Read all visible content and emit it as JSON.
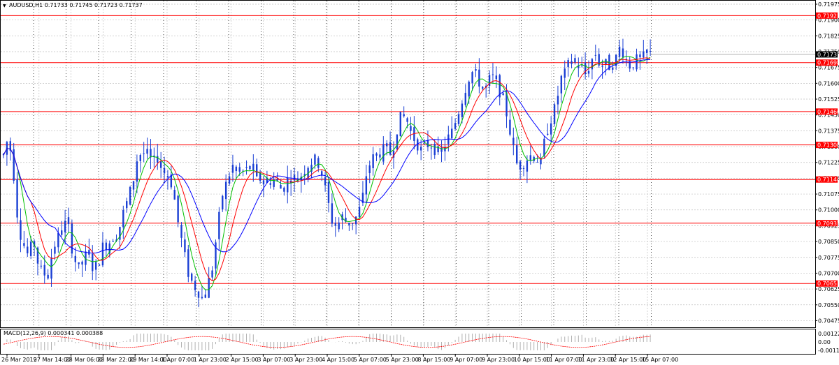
{
  "window": {
    "symbol_line": "AUDUSD,H1  0.71733 0.71745 0.71723 0.71737"
  },
  "chart_data": [
    {
      "type": "candlestick",
      "symbol": "AUDUSD",
      "timeframe": "H1",
      "ohlc_header": {
        "open": 0.71733,
        "high": 0.71745,
        "low": 0.71723,
        "close": 0.71737
      },
      "current_price_label": "0.71737",
      "current_price": 0.71737,
      "ylim": [
        0.7045,
        0.71975
      ],
      "y_tick_labels": [
        "0.71975",
        "0.71900",
        "0.71825",
        "0.71750",
        "0.71675",
        "0.71600",
        "0.71525",
        "0.71450",
        "0.71375",
        "0.71300",
        "0.71225",
        "0.71150",
        "0.71075",
        "0.71000",
        "0.70925",
        "0.70850",
        "0.70775",
        "0.70700",
        "0.70625",
        "0.70550",
        "0.70475"
      ],
      "x_tick_labels": [
        "26 Mar 2019",
        "27 Mar 14:00",
        "28 Mar 06:00",
        "28 Mar 22:00",
        "29 Mar 14:00",
        "1 Apr 07:00",
        "1 Apr 23:00",
        "2 Apr 15:00",
        "3 Apr 07:00",
        "3 Apr 23:00",
        "4 Apr 15:00",
        "5 Apr 07:00",
        "5 Apr 23:00",
        "8 Apr 15:00",
        "9 Apr 07:00",
        "9 Apr 23:00",
        "10 Apr 15:00",
        "11 Apr 07:00",
        "11 Apr 23:00",
        "12 Apr 15:00",
        "15 Apr 07:00"
      ],
      "horizontal_levels": [
        {
          "value": 0.71921,
          "label": "0.71921"
        },
        {
          "value": 0.71698,
          "label": "0.71698"
        },
        {
          "value": 0.71466,
          "label": "0.71466"
        },
        {
          "value": 0.71308,
          "label": "0.71308"
        },
        {
          "value": 0.71144,
          "label": "0.71144"
        },
        {
          "value": 0.70937,
          "label": "0.70937"
        },
        {
          "value": 0.70651,
          "label": "0.70651"
        }
      ],
      "close_path": {
        "x_index": [
          0,
          4,
          9,
          14,
          19,
          25,
          30,
          35,
          40,
          46,
          51,
          56,
          61,
          66,
          71,
          77,
          82,
          87,
          92,
          97,
          103,
          108,
          113,
          118,
          123,
          128,
          133,
          138,
          144,
          149,
          154,
          159,
          164,
          169,
          174,
          180,
          185,
          190,
          195,
          200,
          205,
          210,
          215,
          220,
          226,
          231,
          236,
          241,
          246,
          251,
          256,
          261,
          266,
          271,
          276,
          281,
          286,
          291,
          296,
          301,
          306,
          311,
          316,
          321,
          326,
          331,
          336,
          341,
          346,
          351,
          356,
          361,
          366,
          371,
          376,
          381,
          386,
          391,
          396,
          401,
          406,
          411,
          416,
          421,
          426,
          432,
          437,
          442,
          447,
          452,
          457,
          462,
          467,
          472,
          477,
          482,
          487,
          492,
          497,
          502,
          507,
          512,
          517,
          522,
          527,
          532,
          537,
          542,
          547,
          552,
          557,
          562,
          567,
          572,
          577,
          582,
          587,
          592,
          597,
          602,
          607,
          612,
          617,
          622,
          627,
          632,
          637,
          642,
          647,
          652,
          657,
          662,
          667,
          672,
          677,
          682,
          687,
          692,
          697,
          702,
          707,
          712,
          717,
          722,
          727,
          732,
          737,
          742,
          747,
          752,
          757,
          762,
          767,
          772,
          777,
          782,
          787,
          792,
          797,
          802,
          807,
          812,
          817,
          822,
          827,
          832,
          837,
          842,
          847,
          852,
          857,
          862,
          867,
          872,
          877,
          882,
          887,
          892,
          897,
          902,
          907,
          912,
          917,
          922,
          927,
          932
        ],
        "close": [
          0.7126,
          0.7135,
          0.7118,
          0.7092,
          0.7084,
          0.7078,
          0.7086,
          0.7074,
          0.7069,
          0.7071,
          0.7082,
          0.7087,
          0.7094,
          0.7092,
          0.7079,
          0.7072,
          0.7075,
          0.7081,
          0.7072,
          0.7074,
          0.7083,
          0.7084,
          0.7087,
          0.7089,
          0.7098,
          0.7105,
          0.7113,
          0.7126,
          0.7127,
          0.7126,
          0.7122,
          0.7125,
          0.7118,
          0.7117,
          0.7111,
          0.7095,
          0.7083,
          0.7071,
          0.7065,
          0.7062,
          0.7058,
          0.7064,
          0.7073,
          0.7091,
          0.7107,
          0.7114,
          0.7121,
          0.7117,
          0.7118,
          0.7119,
          0.7121,
          0.7113,
          0.7116,
          0.7112,
          0.7115,
          0.7113,
          0.7109,
          0.7114,
          0.7116,
          0.7114,
          0.7117,
          0.7121,
          0.7123,
          0.7124,
          0.7117,
          0.7106,
          0.7095,
          0.7092,
          0.7097,
          0.7094,
          0.7094,
          0.7097,
          0.7103,
          0.7118,
          0.7124,
          0.7126,
          0.7128,
          0.7129,
          0.7126,
          0.7138,
          0.7145,
          0.7143,
          0.7136,
          0.7132,
          0.7128,
          0.7131,
          0.7131,
          0.7128,
          0.7126,
          0.7133,
          0.7136,
          0.7143,
          0.7151,
          0.7159,
          0.7166,
          0.7163,
          0.7159,
          0.7157,
          0.7164,
          0.716,
          0.7155,
          0.7147,
          0.7135,
          0.7122,
          0.7121,
          0.7124,
          0.7126,
          0.7125,
          0.7122,
          0.7136,
          0.7143,
          0.7149,
          0.7162,
          0.7165,
          0.7172,
          0.7169,
          0.7168,
          0.7164,
          0.717,
          0.7174,
          0.7168,
          0.7169,
          0.7168,
          0.7171,
          0.7178,
          0.7172,
          0.7168,
          0.7171,
          0.7171,
          0.7173,
          0.7174
        ],
        "note_x": "x_index is hourly bar index; values approximate"
      },
      "moving_averages": [
        {
          "color": "#00c000",
          "period_hint": "fast"
        },
        {
          "color": "#ff0000",
          "period_hint": "medium"
        },
        {
          "color": "#0000ff",
          "period_hint": "slow"
        }
      ],
      "grid": true
    },
    {
      "type": "histogram",
      "indicator_label": "MACD(12,26,9) 0.000341 0.000388",
      "name": "MACD",
      "params": [
        12,
        26,
        9
      ],
      "main_value": 0.000341,
      "signal_value": 0.000388,
      "y_tick_labels": [
        "0.001228",
        "0.00",
        "-0.001169"
      ],
      "ylim": [
        -0.001169,
        0.001228
      ]
    }
  ],
  "colors": {
    "candles": "#1a3fd4",
    "level_lines": "#ff0000",
    "level_label_bg": "#ff0000",
    "price_label_bg": "#000000",
    "grid": "#c0c0c0"
  }
}
